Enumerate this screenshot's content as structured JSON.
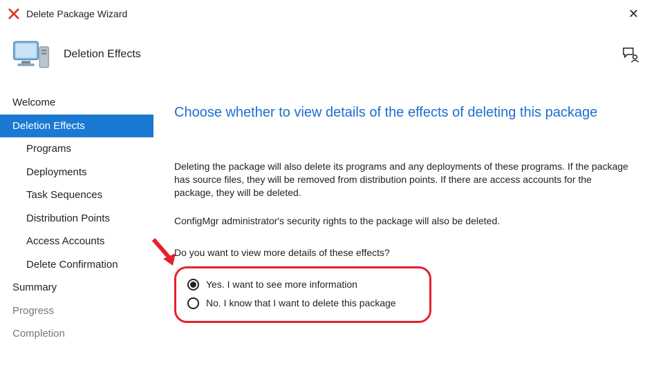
{
  "window": {
    "title": "Delete Package Wizard"
  },
  "header": {
    "page_title": "Deletion Effects"
  },
  "sidebar": {
    "items": [
      {
        "label": "Welcome",
        "indent": false,
        "selected": false,
        "muted": false
      },
      {
        "label": "Deletion Effects",
        "indent": false,
        "selected": true,
        "muted": false
      },
      {
        "label": "Programs",
        "indent": true,
        "selected": false,
        "muted": false
      },
      {
        "label": "Deployments",
        "indent": true,
        "selected": false,
        "muted": false
      },
      {
        "label": "Task Sequences",
        "indent": true,
        "selected": false,
        "muted": false
      },
      {
        "label": "Distribution Points",
        "indent": true,
        "selected": false,
        "muted": false
      },
      {
        "label": "Access Accounts",
        "indent": true,
        "selected": false,
        "muted": false
      },
      {
        "label": "Delete Confirmation",
        "indent": true,
        "selected": false,
        "muted": false
      },
      {
        "label": "Summary",
        "indent": false,
        "selected": false,
        "muted": false
      },
      {
        "label": "Progress",
        "indent": false,
        "selected": false,
        "muted": true
      },
      {
        "label": "Completion",
        "indent": false,
        "selected": false,
        "muted": true
      }
    ]
  },
  "content": {
    "heading": "Choose whether to view details of the effects of deleting this package",
    "para1": "Deleting the package will also delete its programs and any deployments of these programs. If the package has source files, they will be removed from distribution points. If there are access accounts for the package, they will be deleted.",
    "para2": "ConfigMgr administrator's security rights to the package will also be deleted.",
    "question": "Do you want to view more details of these effects?",
    "options": [
      {
        "label": "Yes. I want to see more information",
        "checked": true
      },
      {
        "label": "No. I know that I want to delete this package",
        "checked": false
      }
    ]
  }
}
